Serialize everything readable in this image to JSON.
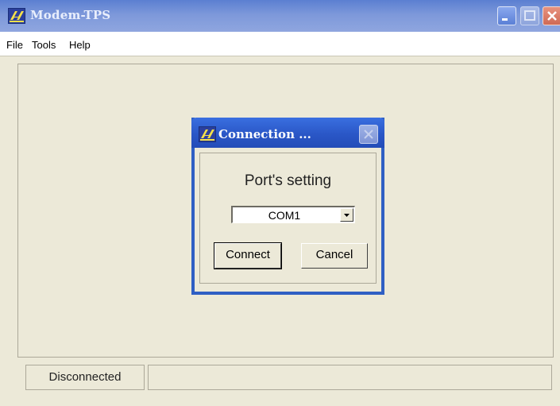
{
  "window": {
    "title": "Modem-TPS"
  },
  "menu": {
    "items": [
      "File",
      "Tools",
      "Help"
    ]
  },
  "dialog": {
    "title": "Connection ...",
    "port_label": "Port's setting",
    "port_select": {
      "value": "COM1"
    },
    "connect_label": "Connect",
    "cancel_label": "Cancel"
  },
  "status": {
    "connection": "Disconnected",
    "info": ""
  },
  "icons": {
    "app": "app-logo-icon",
    "minimize": "minimize-icon",
    "maximize": "maximize-icon",
    "close": "close-icon",
    "dropdown": "chevron-down-icon"
  },
  "colors": {
    "titlebar": "#7d98da",
    "dialog_titlebar": "#2a57c7",
    "face": "#ece9d8",
    "close": "#cf6a55"
  }
}
